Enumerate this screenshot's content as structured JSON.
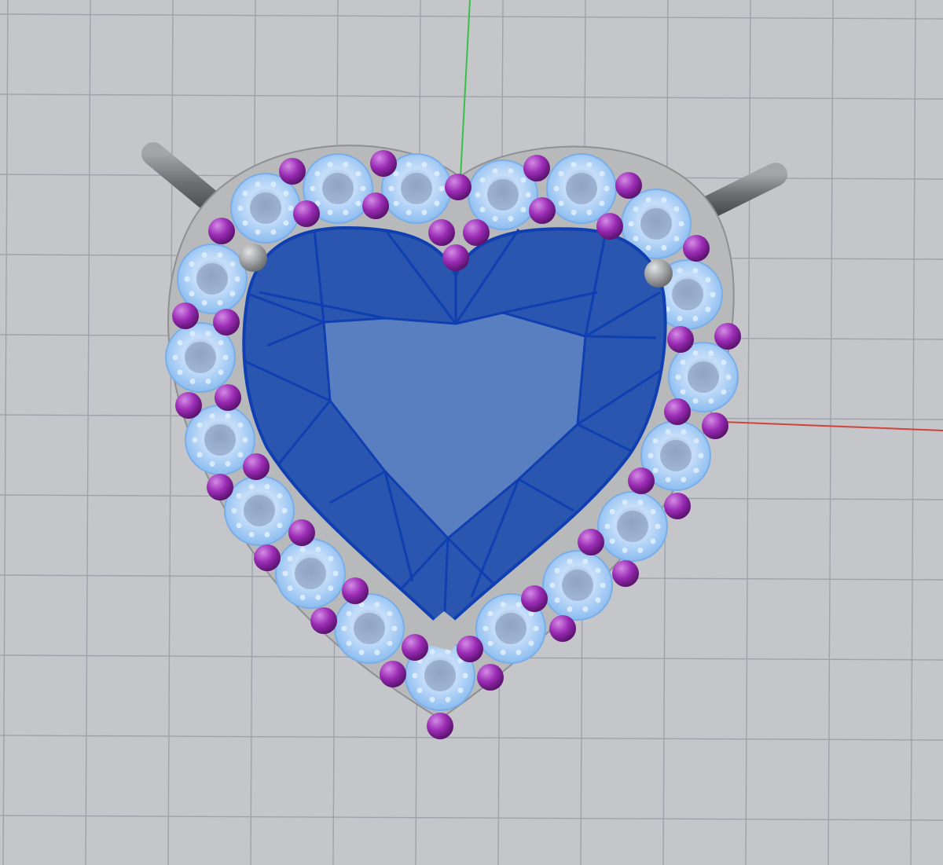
{
  "viewport": {
    "background": "#c4c6ca",
    "grid_color": "#9ea3ab",
    "axis_x_color": "#d0433b",
    "axis_y_color": "#36c04a"
  },
  "model": {
    "center_stone_color": "#2a56b0",
    "center_stone_table_color": "#5a7fc0",
    "facet_line_color": "#0f3fb0",
    "halo_stone_color": "#a9cdf7",
    "prong_color": "#9a2bb4",
    "metal_color": "#b8b9bb",
    "bail_color": "#7e8083"
  }
}
